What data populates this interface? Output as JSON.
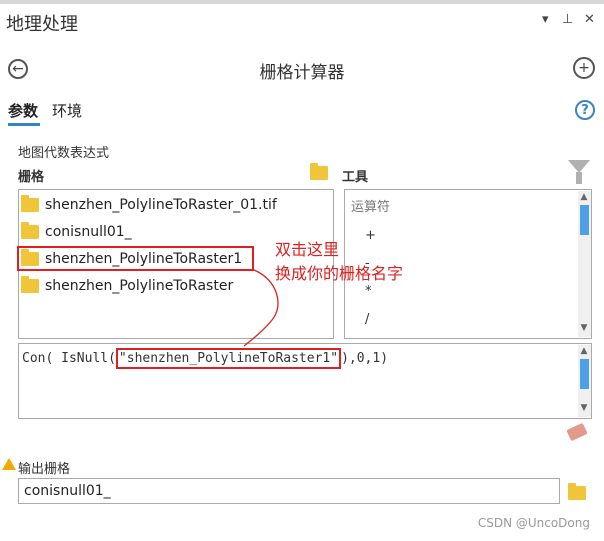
{
  "pane": {
    "title": "地理处理",
    "controls": {
      "dropdown": "▾",
      "pin": "⊥",
      "close": "✕"
    }
  },
  "tool": {
    "title": "栅格计算器"
  },
  "tabs": [
    {
      "label": "参数",
      "active": true
    },
    {
      "label": "环境",
      "active": false
    }
  ],
  "section": {
    "label": "地图代数表达式",
    "rasters_label": "栅格",
    "tools_label": "工具"
  },
  "rasters": [
    "shenzhen_PolylineToRaster_01.tif",
    "conisnull01_",
    "shenzhen_PolylineToRaster1",
    "shenzhen_PolylineToRaster"
  ],
  "operators": {
    "header": "运算符",
    "items": [
      "+",
      "-",
      "*",
      "/"
    ]
  },
  "expression": {
    "prefix": "Con( IsNull(",
    "highlighted": "\"shenzhen_PolylineToRaster1\"",
    "suffix": "),0,1)"
  },
  "annotation": {
    "line1": "双击这里",
    "line2": "换成你的栅格名字"
  },
  "output": {
    "label": "输出栅格",
    "value": "conisnull01_"
  },
  "watermark": "CSDN @UncoDong",
  "colors": {
    "accent": "#3b82c4",
    "annotation_red": "#e02020",
    "folder": "#f0c53a"
  }
}
